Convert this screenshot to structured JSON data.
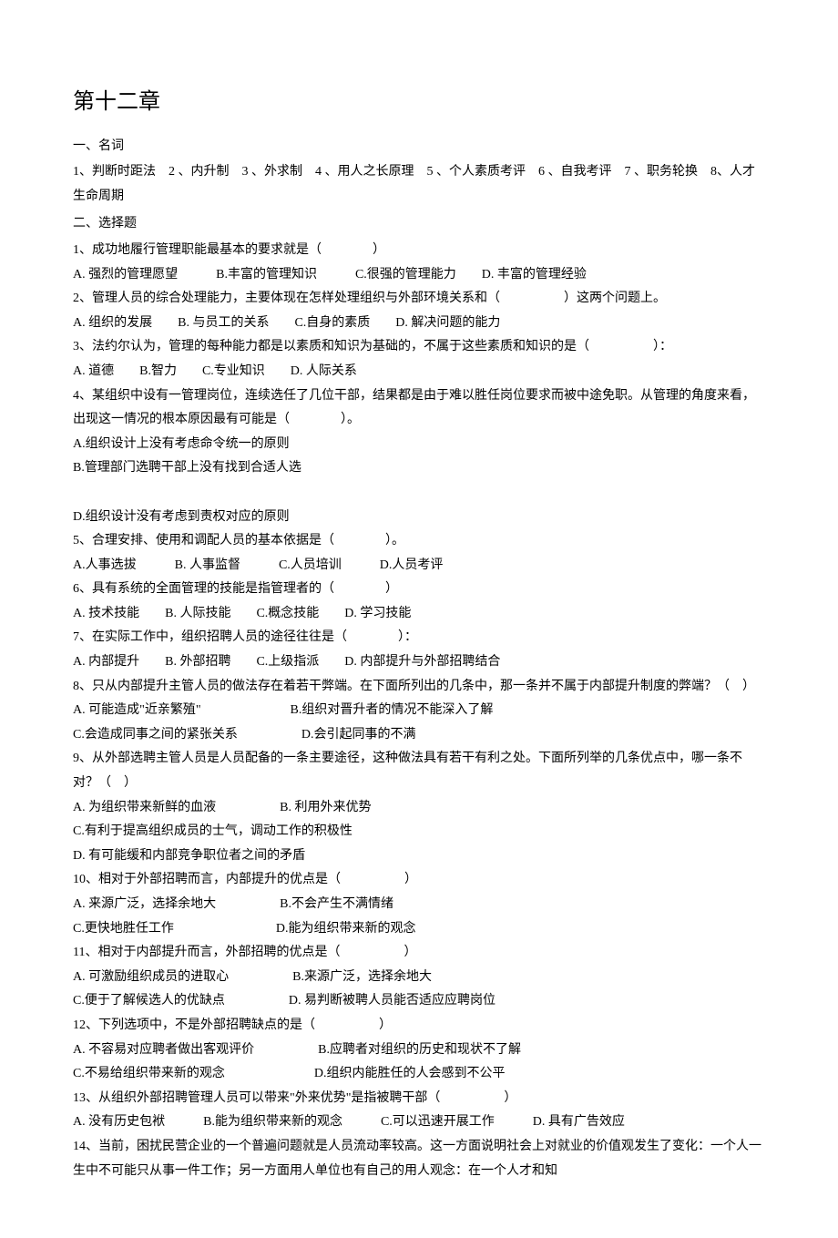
{
  "title": "第十二章",
  "section1": {
    "heading": "一、名词",
    "terms_line": "1、判断时距法　2 、内升制　3 、外求制　4 、用人之长原理　5 、个人素质考评　6 、自我考评　7 、职务轮换　8、人才生命周期"
  },
  "section2": {
    "heading": "二、选择题",
    "q1": {
      "stem": "1、成功地履行管理职能最基本的要求就是（　　　　）",
      "opts": "A. 强烈的管理愿望　　　B.丰富的管理知识　　　C.很强的管理能力　　D. 丰富的管理经验"
    },
    "q2": {
      "stem": "2、管理人员的综合处理能力，主要体现在怎样处理组织与外部环境关系和（　　　　　）这两个问题上。",
      "opts": "A. 组织的发展　　B. 与员工的关系　　C.自身的素质　　D. 解决问题的能力"
    },
    "q3": {
      "stem": "3、法约尔认为，管理的每种能力都是以素质和知识为基础的，不属于这些素质和知识的是（　　　　　）：",
      "opts": "A. 道德　　B.智力　　C.专业知识　　D. 人际关系"
    },
    "q4": {
      "stem1": "4、某组织中设有一管理岗位，连续选任了几位干部，结果都是由于难以胜任岗位要求而被中途免职。从管理的角度来看，出现这一情况的根本原因最有可能是（　　　　）。",
      "optA": "A.组织设计上没有考虑命令统一的原则",
      "optB": "B.管理部门选聘干部上没有找到合适人选",
      "optD": "D.组织设计没有考虑到责权对应的原则"
    },
    "q5": {
      "stem": "5、合理安排、使用和调配人员的基本依据是（　　　　）。",
      "opts": "A.人事选拔　　　B. 人事监督　　　C.人员培训　　　D.人员考评"
    },
    "q6": {
      "stem": "6、具有系统的全面管理的技能是指管理者的（　　　　）",
      "opts": "A. 技术技能　　B. 人际技能　　C.概念技能　　D. 学习技能"
    },
    "q7": {
      "stem": "7、在实际工作中，组织招聘人员的途径往往是（　　　　）：",
      "opts": "A. 内部提升　　B. 外部招聘　　C.上级指派　　D. 内部提升与外部招聘结合"
    },
    "q8": {
      "stem": "8、只从内部提升主管人员的做法存在着若干弊端。在下面所列出的几条中，那一条并不属于内部提升制度的弊端？（　）",
      "row1": "A. 可能造成\"近亲繁殖\"　　　　　　　B.组织对晋升者的情况不能深入了解",
      "row2": "C.会造成同事之间的紧张关系　　　　　D.会引起同事的不满"
    },
    "q9": {
      "stem": "9、从外部选聘主管人员是人员配备的一条主要途径，这种做法具有若干有利之处。下面所列举的几条优点中，哪一条不对？（　）",
      "row1": "A. 为组织带来新鲜的血液　　　　　B. 利用外来优势",
      "row2": "C.有利于提高组织成员的士气，调动工作的积极性",
      "row3": "D. 有可能缓和内部竞争职位者之间的矛盾"
    },
    "q10": {
      "stem": "10、相对于外部招聘而言，内部提升的优点是（　　　　　）",
      "row1": "A. 来源广泛，选择余地大　　　　　B.不会产生不满情绪",
      "row2": "C.更快地胜任工作　　　　　　　　D.能为组织带来新的观念"
    },
    "q11": {
      "stem": "11、相对于内部提升而言，外部招聘的优点是（　　　　　）",
      "row1": "A. 可激励组织成员的进取心　　　　　B.来源广泛，选择余地大",
      "row2": "C.便于了解候选人的优缺点　　　　　D. 易判断被聘人员能否适应应聘岗位"
    },
    "q12": {
      "stem": "12、下列选项中，不是外部招聘缺点的是（　　　　　）",
      "row1": "A. 不容易对应聘者做出客观评价　　　　　B.应聘者对组织的历史和现状不了解",
      "row2": "C.不易给组织带来新的观念　　　　　　　D.组织内能胜任的人会感到不公平"
    },
    "q13": {
      "stem": "13、从组织外部招聘管理人员可以带来\"外来优势\"是指被聘干部（　　　　　）",
      "opts": "A. 没有历史包袱　　　B.能为组织带来新的观念　　　C.可以迅速开展工作　　　D. 具有广告效应"
    },
    "q14": {
      "stem": "14、当前，困扰民营企业的一个普遍问题就是人员流动率较高。这一方面说明社会上对就业的价值观发生了变化：一个人一生中不可能只从事一件工作；另一方面用人单位也有自己的用人观念：在一个人才和知"
    }
  }
}
